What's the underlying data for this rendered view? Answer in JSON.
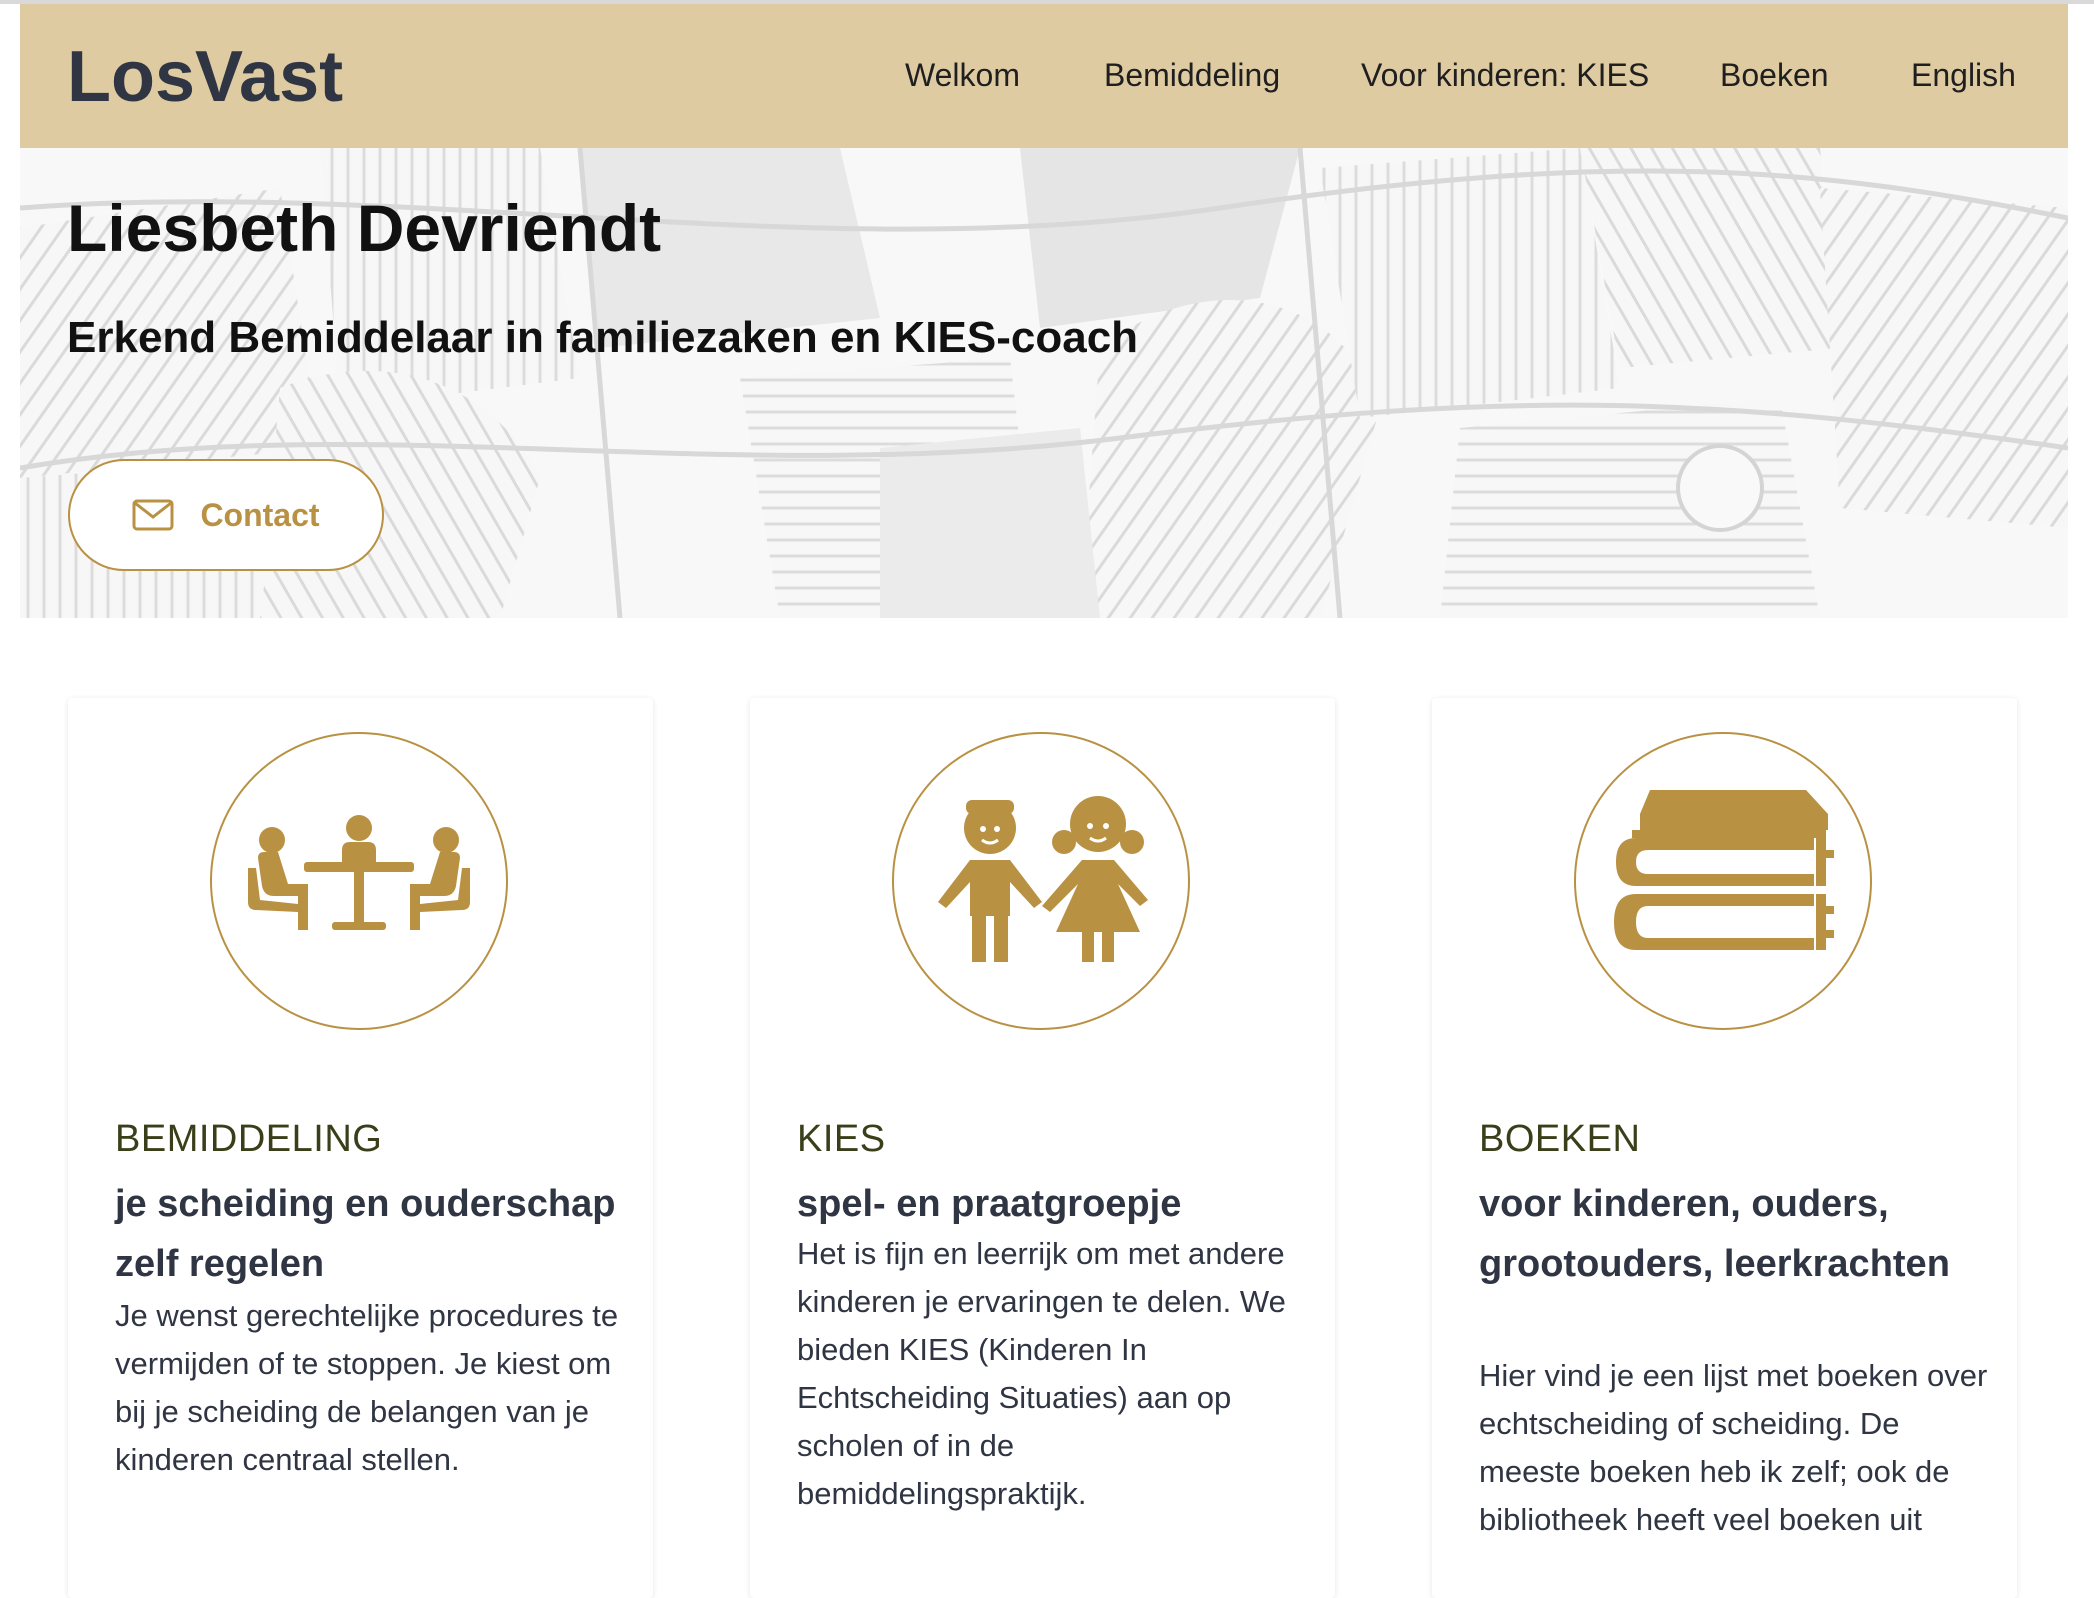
{
  "navbar": {
    "brand": "LosVast",
    "items": [
      "Welkom",
      "Bemiddeling",
      "Voor kinderen: KIES",
      "Boeken",
      "English"
    ]
  },
  "hero": {
    "title": "Liesbeth Devriendt",
    "subtitle": "Erkend Bemiddelaar in familiezaken en KIES-coach",
    "contact_label": "Contact"
  },
  "cards": [
    {
      "icon": "meeting-table-icon",
      "heading": "BEMIDDELING",
      "subheading": "je scheiding en ouderschap zelf regelen",
      "text": "Je wenst gerechtelijke procedures te vermijden of te stoppen. Je kiest om bij je scheiding de belangen van je kinderen centraal stellen."
    },
    {
      "icon": "children-icon",
      "heading": "KIES",
      "subheading": "spel- en praatgroepje",
      "text": "Het is fijn en leerrijk om met andere kinderen je ervaringen te delen. We bieden KIES (Kinderen In Echtscheiding Situaties) aan op scholen of in de bemiddelingspraktijk."
    },
    {
      "icon": "books-icon",
      "heading": "BOEKEN",
      "subheading": "voor kinderen, ouders, grootouders, leerkrachten",
      "text": "Hier vind je een lijst met boeken over echtscheiding of scheiding. De meeste boeken heb ik zelf; ook de bibliotheek heeft veel boeken uit"
    }
  ],
  "colors": {
    "navbar_bg": "#dfcba2",
    "accent_gold": "#b99143",
    "heading_olive": "#3a3f1a",
    "text_dark": "#2f3542"
  }
}
